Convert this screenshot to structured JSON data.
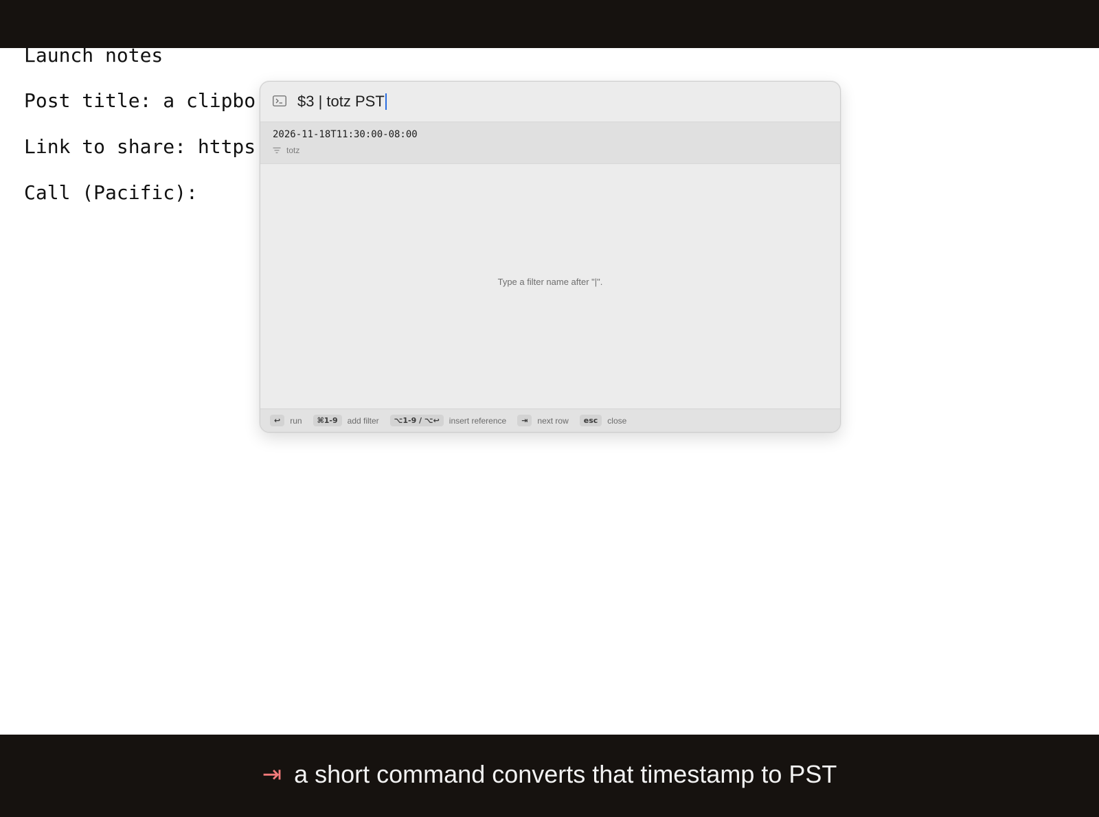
{
  "document": {
    "lines": [
      "Launch notes",
      "Post title: a clipbo",
      "Link to share: https",
      "Call (Pacific):"
    ]
  },
  "palette": {
    "icon": "terminal-icon",
    "query": "$3 | totz PST",
    "result": {
      "value": "2026-11-18T11:30:00-08:00",
      "filter_icon": "filter-icon",
      "filter_name": "totz"
    },
    "hint": "Type a filter name after \"|\".",
    "footer": [
      {
        "key": "↩",
        "label": "run"
      },
      {
        "key": "⌘1-9",
        "label": "add filter"
      },
      {
        "key": "⌥1-9 / ⌥↩",
        "label": "insert reference"
      },
      {
        "key": "⇥",
        "label": "next row"
      },
      {
        "key": "esc",
        "label": "close"
      }
    ]
  },
  "caption": {
    "icon": "tab-arrow-icon",
    "glyph": "⇥",
    "text": "a short command converts that timestamp to PST"
  },
  "colors": {
    "bar_bg": "#16120f",
    "caption_accent": "#f27a7a",
    "caret": "#2a6de0"
  }
}
